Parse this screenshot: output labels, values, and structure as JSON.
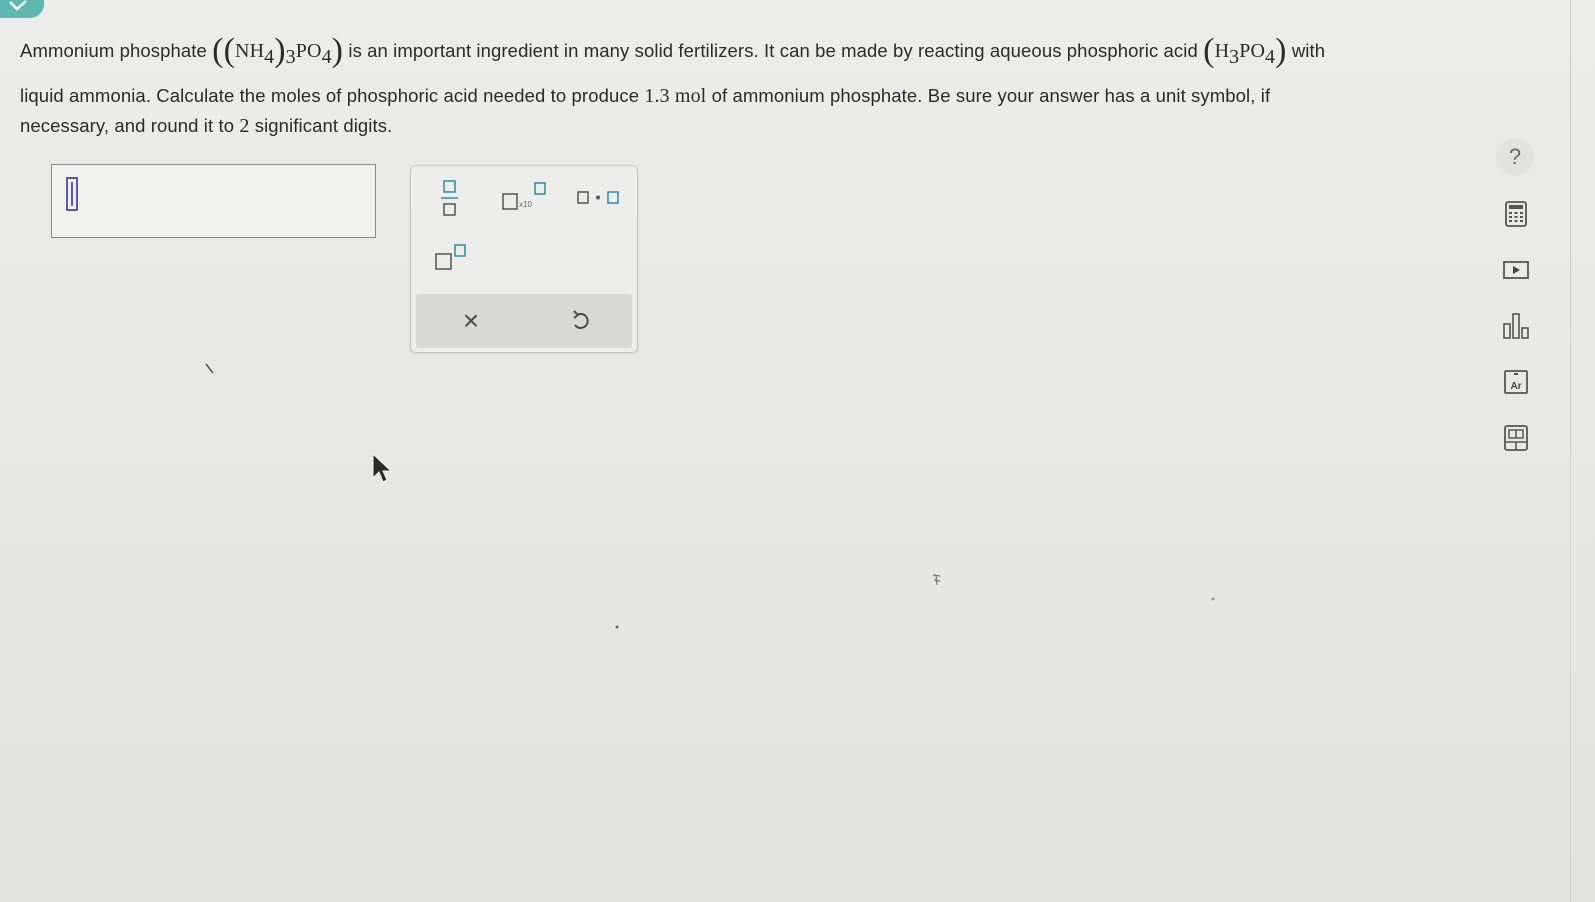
{
  "question": {
    "line1_a": "Ammonium phosphate",
    "line1_b": "is an important ingredient in many solid fertilizers. It can be made by reacting aqueous phosphoric acid",
    "line1_c": "with",
    "line2_a": "liquid ammonia. Calculate the moles of phosphoric acid needed to produce",
    "line2_b": "of ammonium phosphate. Be sure your answer has a unit symbol, if",
    "line3_a": "necessary, and round it to",
    "line3_b": "significant digits.",
    "formula_ammonium": {
      "a": "NH",
      "a_sub": "4",
      "b_sub": "3",
      "c": "PO",
      "c_sub": "4"
    },
    "formula_acid": {
      "a": "H",
      "a_sub": "3",
      "b": "PO",
      "b_sub": "4"
    },
    "amount_value": "1.3",
    "amount_unit": "mol",
    "sig_digits": "2"
  },
  "answer": {
    "value": ""
  },
  "palette": {
    "tools": [
      "fraction-icon",
      "scientific-notation-icon",
      "multiply-dot-icon",
      "superscript-icon"
    ],
    "sci_label": "x10",
    "clear_symbol": "×",
    "undo_symbol": "↺"
  },
  "side_tools": {
    "help_label": "?",
    "items": [
      "calculator-icon",
      "video-play-icon",
      "bar-chart-icon",
      "periodic-table-icon",
      "data-table-icon"
    ],
    "periodic_symbol": "Ar"
  },
  "colors": {
    "accent": "#5fb8b0",
    "caret": "#5a55c8",
    "tool_teal": "#2a8fa0"
  }
}
